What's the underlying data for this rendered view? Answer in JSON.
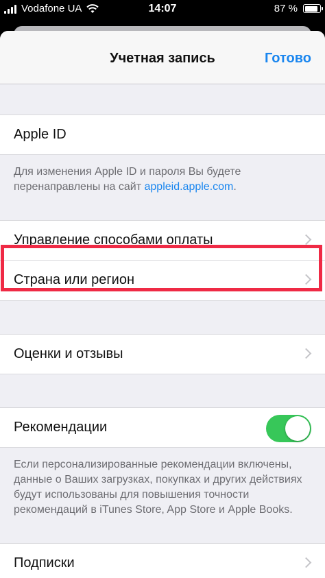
{
  "status_bar": {
    "carrier": "Vodafone UA",
    "time": "14:07",
    "battery_text": "87 %",
    "battery_level": 0.87
  },
  "nav": {
    "title": "Учетная запись",
    "done_label": "Готово"
  },
  "apple_id": {
    "label": "Apple ID",
    "footer_text": "Для изменения Apple ID и пароля Вы будете перенаправлены на сайт ",
    "footer_link": "appleid.apple.com",
    "footer_end": "."
  },
  "payment": {
    "label": "Управление способами оплаты"
  },
  "country": {
    "label": "Страна или регион"
  },
  "ratings": {
    "label": "Оценки и отзывы"
  },
  "recommendations": {
    "label": "Рекомендации",
    "enabled": true,
    "footer_text": "Если персонализированные рекомендации включены, данные о Ваших загрузках, покупках и других действиях будут использованы для повышения точности рекомендаций в iTunes Store, App Store и Apple Books."
  },
  "subscriptions": {
    "label": "Подписки"
  },
  "colors": {
    "accent": "#1a86ef",
    "toggle_on": "#37c759",
    "highlight": "#ef2a45"
  }
}
